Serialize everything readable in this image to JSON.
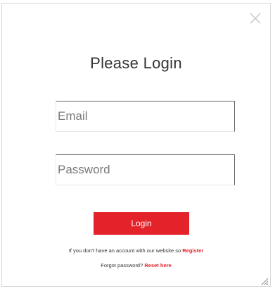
{
  "modal": {
    "close_icon": "close-icon",
    "title": "Please Login",
    "email": {
      "placeholder": "Email",
      "value": ""
    },
    "password": {
      "placeholder": "Password",
      "value": ""
    },
    "login_label": "Login",
    "register_note": {
      "text": "If you don't have an account with our website so ",
      "link": "Register"
    },
    "forgot_note": {
      "text": "Forgot password? ",
      "link": "Reset here"
    },
    "resize_icon": "resize-handle-icon"
  },
  "colors": {
    "accent": "#e42229",
    "border": "#d8d8d8",
    "text": "#333333"
  }
}
